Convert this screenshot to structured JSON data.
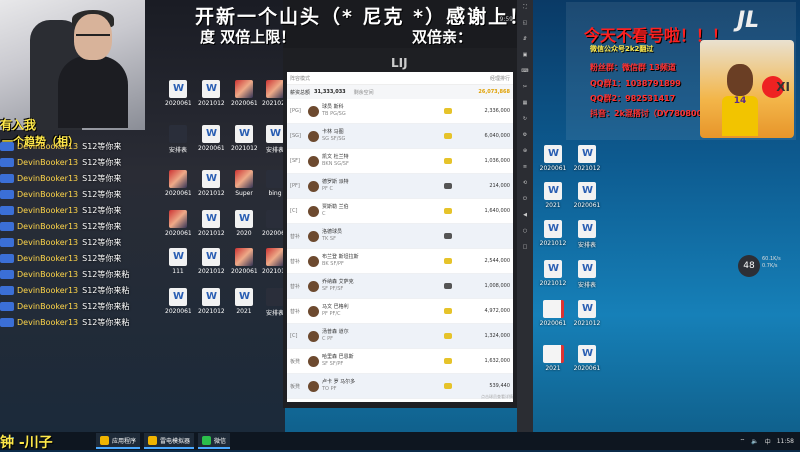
{
  "stream": {
    "marquee_top": "开新一个山头（* 尼克 *）感谢上！",
    "marquee_bottom_left": "度 双倍上限！",
    "marquee_bottom_right": "双倍亲：",
    "overlay_left_1": "有入我",
    "overlay_left_2": "一个趋势（相）",
    "bottom_left_caption": "钟 -川子"
  },
  "chat": [
    {
      "name": "DevinBooker13",
      "text": "S12等你来"
    },
    {
      "name": "DevinBooker13",
      "text": "S12等你来"
    },
    {
      "name": "DevinBooker13",
      "text": "S12等你来"
    },
    {
      "name": "DevinBooker13",
      "text": "S12等你来"
    },
    {
      "name": "DevinBooker13",
      "text": "S12等你来"
    },
    {
      "name": "DevinBooker13",
      "text": "S12等你来"
    },
    {
      "name": "DevinBooker13",
      "text": "S12等你来"
    },
    {
      "name": "DevinBooker13",
      "text": "S12等你来"
    },
    {
      "name": "DevinBooker13",
      "text": "S12等你来粘"
    },
    {
      "name": "DevinBooker13",
      "text": "S12等你来粘"
    },
    {
      "name": "DevinBooker13",
      "text": "S12等你来粘"
    },
    {
      "name": "DevinBooker13",
      "text": "S12等你来粘"
    }
  ],
  "left_icons": [
    {
      "label": "2020061",
      "type": "word"
    },
    {
      "label": "2021012",
      "type": "word"
    },
    {
      "label": "2020061",
      "type": "img"
    },
    {
      "label": "2021021",
      "type": "img"
    },
    {
      "label": "安排表",
      "type": "dark"
    },
    {
      "label": "2020061",
      "type": "word"
    },
    {
      "label": "2021012",
      "type": "word"
    },
    {
      "label": "安排表",
      "type": "word"
    },
    {
      "label": "2020061",
      "type": "img"
    },
    {
      "label": "2021012",
      "type": "word"
    },
    {
      "label": "Super",
      "type": "img"
    },
    {
      "label": "bing",
      "type": "dark"
    },
    {
      "label": "2020061",
      "type": "img"
    },
    {
      "label": "2021012",
      "type": "word"
    },
    {
      "label": "2020",
      "type": "word"
    },
    {
      "label": "2020061",
      "type": "dark"
    },
    {
      "label": "111",
      "type": "word"
    },
    {
      "label": "2021012",
      "type": "word"
    },
    {
      "label": "2020061",
      "type": "img"
    },
    {
      "label": "2021012",
      "type": "img"
    },
    {
      "label": "2020061",
      "type": "word"
    },
    {
      "label": "2021012",
      "type": "word"
    },
    {
      "label": "2021",
      "type": "word"
    },
    {
      "label": "安排表",
      "type": "dark"
    }
  ],
  "emulator": {
    "status_time": "9:59",
    "brand": "LIJ",
    "sheet_header_left": "阵容模式",
    "sheet_header_right": "经理排行",
    "salary_label": "薪资总额",
    "salary_total": "31,333,033",
    "salary_sub": "剩余空间",
    "salary_right": "26,073,868",
    "footer": "点击球员查看详情",
    "rows": [
      {
        "pos": "[PG]",
        "name": "球员 斯科",
        "team": "TB PG/SG",
        "salary": "2,336,000",
        "badge": "gold"
      },
      {
        "pos": "[SG]",
        "name": "卡林 马图",
        "team": "SG SF/SG",
        "salary": "6,040,000",
        "badge": "gold"
      },
      {
        "pos": "[SF]",
        "name": "凯文 杜兰特",
        "team": "BKN SG/SF",
        "salary": "1,036,000",
        "badge": "gold"
      },
      {
        "pos": "[PF]",
        "name": "德罗斯 派特",
        "team": "PF C",
        "salary": "214,000",
        "badge": "dark"
      },
      {
        "pos": "[C]",
        "name": "贾斯勒 兰伯",
        "team": "C",
        "salary": "1,640,000",
        "badge": "gold"
      },
      {
        "pos": "替补",
        "name": "洛德球员",
        "team": "TK SF",
        "salary": "",
        "badge": "dark"
      },
      {
        "pos": "替补",
        "name": "布兰登 斯坦拉斯",
        "team": "BK SF/PF",
        "salary": "2,544,000",
        "badge": "gold"
      },
      {
        "pos": "替补",
        "name": "乔纳森 艾萨克",
        "team": "SF PF/SF",
        "salary": "1,008,000",
        "badge": "dark"
      },
      {
        "pos": "替补",
        "name": "马文 巴格利",
        "team": "PF PF/C",
        "salary": "4,972,000",
        "badge": "gold"
      },
      {
        "pos": "[C]",
        "name": "汤普森 道尔",
        "team": "C PF",
        "salary": "1,324,000",
        "badge": "gold"
      },
      {
        "pos": "板凳",
        "name": "哈里森 巴恩斯",
        "team": "SF SF/PF",
        "salary": "1,632,000",
        "badge": "gold"
      },
      {
        "pos": "板凳",
        "name": "卢卡 罗 马尔多",
        "team": "TO PF",
        "salary": "539,440",
        "badge": "gold"
      }
    ]
  },
  "emu_side_buttons": [
    "⛶",
    "◱",
    "⇵",
    "▣",
    "⌨",
    "✂",
    "▦",
    "↻",
    "⚙",
    "⊕",
    "≡",
    "⟲",
    "⏻",
    "◀",
    "○",
    "□"
  ],
  "right_panel": {
    "headline": "今天不看号啦！！！",
    "line1": "微信公众号2k2翻过",
    "line2": "粉丝群：微信群 13频道",
    "line3": "QQ群1：1038791899",
    "line4": "QQ群2：982531417",
    "line5": "抖音：2k混搭讨（DY780800）",
    "card_label": "XI",
    "jersey": "14"
  },
  "right_icons": [
    {
      "label": "2020061",
      "type": "word"
    },
    {
      "label": "2021012",
      "type": "word"
    },
    {
      "label": "2021",
      "type": "word"
    },
    {
      "label": "2020061",
      "type": "word"
    },
    {
      "label": "2021012",
      "type": "word"
    },
    {
      "label": "安排表",
      "type": "word"
    },
    {
      "label": "2021012",
      "type": "word"
    },
    {
      "label": "安排表",
      "type": "word"
    },
    {
      "label": "2020061",
      "type": "pdf"
    },
    {
      "label": "2021012",
      "type": "word"
    },
    {
      "label": "2021",
      "type": "pdf"
    },
    {
      "label": "2020061",
      "type": "word"
    }
  ],
  "gauge": {
    "value": "48",
    "up": "60.1K/s",
    "down": "0.7K/s"
  },
  "taskbar": {
    "items": [
      "应用程序",
      "雷电模拟器",
      "微信"
    ],
    "tray_time": "11:58",
    "tray_lang": "中"
  }
}
